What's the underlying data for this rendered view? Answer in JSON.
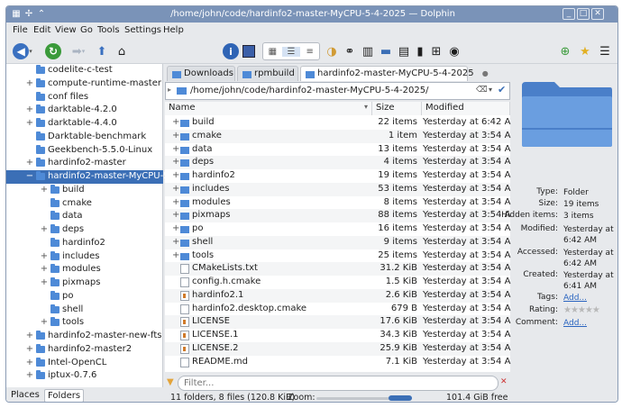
{
  "window": {
    "title": "/home/john/code/hardinfo2-master-MyCPU-5-4-2025 — Dolphin"
  },
  "menu": [
    "File",
    "Edit",
    "View",
    "Go",
    "Tools",
    "Settings",
    "Help"
  ],
  "sidebar": {
    "items": [
      {
        "label": "codelite-c-test",
        "expander": "",
        "level": 0
      },
      {
        "label": "compute-runtime-master",
        "expander": "+",
        "level": 0
      },
      {
        "label": "conf files",
        "expander": "",
        "level": 0
      },
      {
        "label": "darktable-4.2.0",
        "expander": "+",
        "level": 0
      },
      {
        "label": "darktable-4.4.0",
        "expander": "+",
        "level": 0
      },
      {
        "label": "Darktable-benchmark",
        "expander": "",
        "level": 0
      },
      {
        "label": "Geekbench-5.5.0-Linux",
        "expander": "",
        "level": 0
      },
      {
        "label": "hardinfo2-master",
        "expander": "+",
        "level": 0
      },
      {
        "label": "hardinfo2-master-MyCPU-5-4-2025",
        "expander": "−",
        "level": 0,
        "selected": true
      },
      {
        "label": "build",
        "expander": "+",
        "level": 1
      },
      {
        "label": "cmake",
        "expander": "",
        "level": 1
      },
      {
        "label": "data",
        "expander": "",
        "level": 1
      },
      {
        "label": "deps",
        "expander": "+",
        "level": 1
      },
      {
        "label": "hardinfo2",
        "expander": "",
        "level": 1
      },
      {
        "label": "includes",
        "expander": "+",
        "level": 1
      },
      {
        "label": "modules",
        "expander": "+",
        "level": 1
      },
      {
        "label": "pixmaps",
        "expander": "+",
        "level": 1
      },
      {
        "label": "po",
        "expander": "",
        "level": 1
      },
      {
        "label": "shell",
        "expander": "",
        "level": 1
      },
      {
        "label": "tools",
        "expander": "+",
        "level": 1
      },
      {
        "label": "hardinfo2-master-new-fts",
        "expander": "+",
        "level": 0
      },
      {
        "label": "hardinfo2-master2",
        "expander": "+",
        "level": 0
      },
      {
        "label": "Intel-OpenCL",
        "expander": "+",
        "level": 0
      },
      {
        "label": "iptux-0.7.6",
        "expander": "+",
        "level": 0
      }
    ],
    "tabs": [
      "Places",
      "Folders"
    ]
  },
  "tabs": [
    {
      "label": "Downloads"
    },
    {
      "label": "rpmbuild"
    },
    {
      "label": "hardinfo2-master-MyCPU-5-4-2025",
      "active": true
    }
  ],
  "path": "/home/john/code/hardinfo2-master-MyCPU-5-4-2025/",
  "columns": {
    "name": "Name",
    "size": "Size",
    "modified": "Modified"
  },
  "files": [
    {
      "name": "build",
      "type": "folder",
      "size": "22 items",
      "modified": "Yesterday at 6:42 AM",
      "expander": "+"
    },
    {
      "name": "cmake",
      "type": "folder",
      "size": "1 item",
      "modified": "Yesterday at 3:54 AM",
      "expander": "+"
    },
    {
      "name": "data",
      "type": "folder",
      "size": "13 items",
      "modified": "Yesterday at 3:54 AM",
      "expander": "+"
    },
    {
      "name": "deps",
      "type": "folder",
      "size": "4 items",
      "modified": "Yesterday at 3:54 AM",
      "expander": "+"
    },
    {
      "name": "hardinfo2",
      "type": "folder",
      "size": "19 items",
      "modified": "Yesterday at 3:54 AM",
      "expander": "+"
    },
    {
      "name": "includes",
      "type": "folder",
      "size": "53 items",
      "modified": "Yesterday at 3:54 AM",
      "expander": "+"
    },
    {
      "name": "modules",
      "type": "folder",
      "size": "8 items",
      "modified": "Yesterday at 3:54 AM",
      "expander": "+"
    },
    {
      "name": "pixmaps",
      "type": "folder",
      "size": "88 items",
      "modified": "Yesterday at 3:54 AM",
      "expander": "+"
    },
    {
      "name": "po",
      "type": "folder",
      "size": "16 items",
      "modified": "Yesterday at 3:54 AM",
      "expander": "+"
    },
    {
      "name": "shell",
      "type": "folder",
      "size": "9 items",
      "modified": "Yesterday at 3:54 AM",
      "expander": "+"
    },
    {
      "name": "tools",
      "type": "folder",
      "size": "25 items",
      "modified": "Yesterday at 3:54 AM",
      "expander": "+"
    },
    {
      "name": "CMakeLists.txt",
      "type": "doc",
      "size": "31.2 KiB",
      "modified": "Yesterday at 3:54 AM",
      "expander": ""
    },
    {
      "name": "config.h.cmake",
      "type": "doc",
      "size": "1.5 KiB",
      "modified": "Yesterday at 3:54 AM",
      "expander": ""
    },
    {
      "name": "hardinfo2.1",
      "type": "man",
      "size": "2.6 KiB",
      "modified": "Yesterday at 3:54 AM",
      "expander": ""
    },
    {
      "name": "hardinfo2.desktop.cmake",
      "type": "doc",
      "size": "679 B",
      "modified": "Yesterday at 3:54 AM",
      "expander": ""
    },
    {
      "name": "LICENSE",
      "type": "man",
      "size": "17.6 KiB",
      "modified": "Yesterday at 3:54 AM",
      "expander": ""
    },
    {
      "name": "LICENSE.1",
      "type": "man",
      "size": "34.3 KiB",
      "modified": "Yesterday at 3:54 AM",
      "expander": ""
    },
    {
      "name": "LICENSE.2",
      "type": "man",
      "size": "25.9 KiB",
      "modified": "Yesterday at 3:54 AM",
      "expander": ""
    },
    {
      "name": "README.md",
      "type": "doc",
      "size": "7.1 KiB",
      "modified": "Yesterday at 3:54 AM",
      "expander": ""
    }
  ],
  "filter": {
    "placeholder": "Filter..."
  },
  "status": {
    "summary": "11 folders, 8 files (120.8 KiB)",
    "zoom_label": "Zoom:",
    "free": "101.4 GiB free"
  },
  "info": {
    "rows": [
      {
        "key": "Type:",
        "value": "Folder"
      },
      {
        "key": "Size:",
        "value": "19 items"
      },
      {
        "key": "Hidden items:",
        "value": "3 items"
      },
      {
        "key": "Modified:",
        "value": "Yesterday at 6:42 AM"
      },
      {
        "key": "Accessed:",
        "value": "Yesterday at 6:42 AM"
      },
      {
        "key": "Created:",
        "value": "Yesterday at 6:41 AM"
      },
      {
        "key": "Tags:",
        "value": "Add..."
      },
      {
        "key": "Rating:",
        "value": ""
      },
      {
        "key": "Comment:",
        "value": "Add..."
      }
    ],
    "rating": 0
  },
  "colors": {
    "accent": "#3b6fb6",
    "folder": "#4e8ad7",
    "titlebar": "#7a93b8"
  }
}
